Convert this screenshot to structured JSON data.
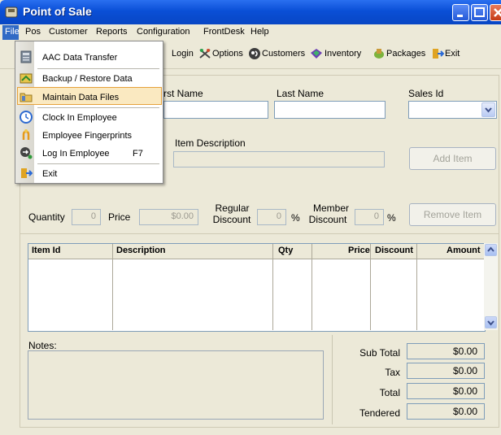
{
  "window": {
    "title": "Point of Sale"
  },
  "menubar": {
    "file": "File",
    "pos": "Pos",
    "customer": "Customer",
    "reports": "Reports",
    "configuration": "Configuration",
    "frontdesk": "FrontDesk",
    "help": "Help"
  },
  "toolbar": {
    "login": "Login",
    "options": "Options",
    "customers": "Customers",
    "inventory": "Inventory",
    "packages": "Packages",
    "exit": "Exit"
  },
  "form": {
    "first_name_label": "rst Name",
    "last_name_label": "Last Name",
    "sales_id_label": "Sales Id",
    "item_description_label": "Item Description",
    "add_item_button": "Add Item",
    "remove_item_button": "Remove Item",
    "quantity_label": "Quantity",
    "quantity_value": "0",
    "price_label": "Price",
    "price_value": "$0.00",
    "regular_discount_label_1": "Regular",
    "regular_discount_label_2": "Discount",
    "regular_discount_value": "0",
    "percent_1": "%",
    "member_discount_label_1": "Member",
    "member_discount_label_2": "Discount",
    "member_discount_value": "0",
    "percent_2": "%"
  },
  "grid": {
    "columns": [
      "Item Id",
      "Description",
      "Qty",
      "Price",
      "Discount",
      "Amount"
    ]
  },
  "notes": {
    "label": "Notes:"
  },
  "totals": {
    "sub_total_label": "Sub Total",
    "sub_total": "$0.00",
    "tax_label": "Tax",
    "tax": "$0.00",
    "total_label": "Total",
    "total": "$0.00",
    "tendered_label": "Tendered",
    "tendered": "$0.00"
  },
  "file_menu": {
    "items": [
      {
        "label": "AAC Data Transfer",
        "icon": "transfer-icon"
      },
      {
        "label": "Backup / Restore Data",
        "icon": "backup-icon"
      },
      {
        "label": "Maintain Data Files",
        "icon": "folder-icon"
      },
      {
        "label": "Clock In Employee",
        "icon": "clock-icon"
      },
      {
        "label": "Employee Fingerprints",
        "icon": "fingerprint-icon"
      },
      {
        "label": "Log In Employee",
        "icon": "login-icon",
        "shortcut": "F7"
      },
      {
        "label": "Exit",
        "icon": "exit-icon"
      }
    ]
  }
}
